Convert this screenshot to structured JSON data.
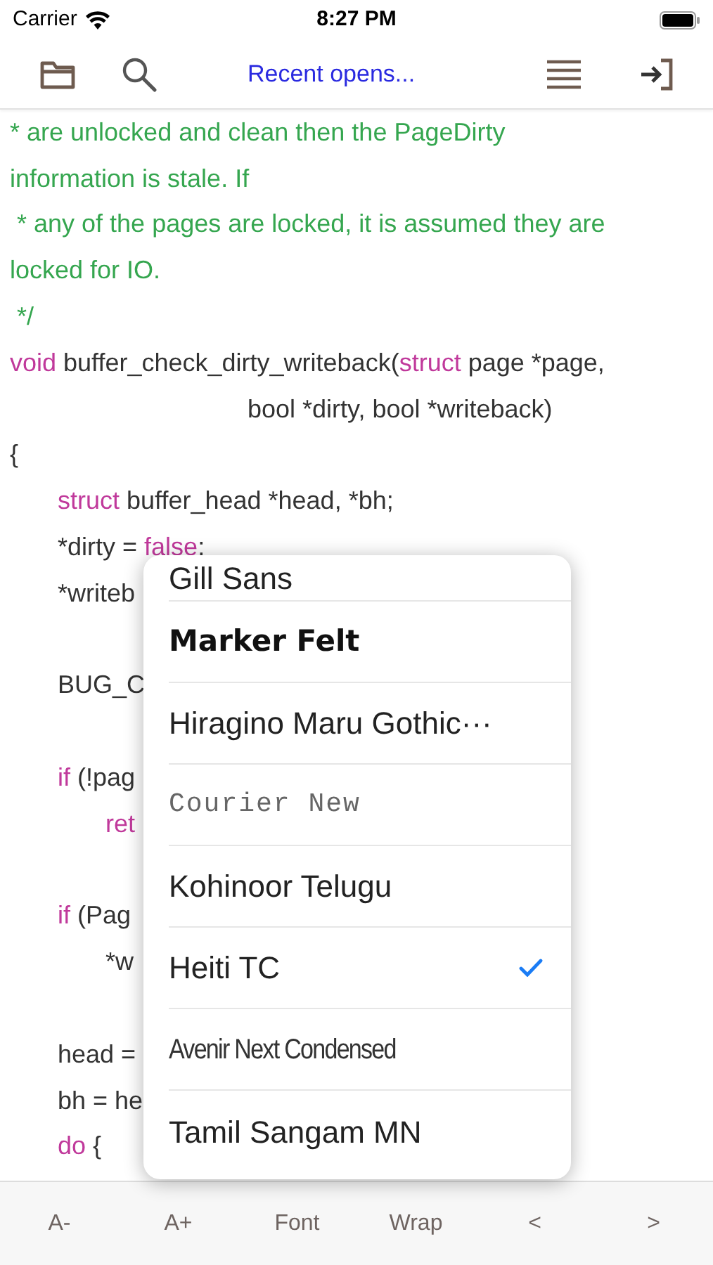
{
  "status_bar": {
    "carrier": "Carrier",
    "time": "8:27 PM"
  },
  "toolbar": {
    "title": "Recent opens..."
  },
  "code": [
    {
      "kind": "line",
      "segments": [
        {
          "kind": "comment",
          "text": "* are unlocked and clean then the PageDirty"
        }
      ]
    },
    {
      "kind": "line",
      "segments": [
        {
          "kind": "comment",
          "text": "information is stale. If"
        }
      ]
    },
    {
      "kind": "line",
      "segments": [
        {
          "kind": "comment",
          "text": " * any of the pages are locked, it is assumed they are"
        }
      ]
    },
    {
      "kind": "line",
      "segments": [
        {
          "kind": "comment",
          "text": "locked for IO."
        }
      ]
    },
    {
      "kind": "line",
      "segments": [
        {
          "kind": "comment",
          "text": " */"
        }
      ]
    },
    {
      "kind": "line",
      "segments": [
        {
          "kind": "keyword",
          "text": "void"
        },
        {
          "kind": "plain",
          "text": " buffer_check_dirty_writeback("
        },
        {
          "kind": "keyword",
          "text": "struct"
        },
        {
          "kind": "plain",
          "text": " page *page,"
        }
      ]
    },
    {
      "kind": "continuation",
      "segments": [
        {
          "kind": "plain",
          "text": "bool *dirty, bool *writeback)"
        }
      ]
    },
    {
      "kind": "line",
      "segments": [
        {
          "kind": "plain",
          "text": "{"
        }
      ],
      "children": [
        {
          "kind": "line",
          "segments": [
            {
              "kind": "keyword",
              "text": "struct"
            },
            {
              "kind": "plain",
              "text": " buffer_head *head, *bh;"
            }
          ]
        },
        {
          "kind": "line",
          "segments": [
            {
              "kind": "plain",
              "text": "*dirty = "
            },
            {
              "kind": "keyword",
              "text": "false"
            },
            {
              "kind": "plain",
              "text": ";"
            }
          ]
        },
        {
          "kind": "line",
          "segments": [
            {
              "kind": "plain",
              "text": "*writeb"
            }
          ]
        },
        {
          "kind": "blank"
        },
        {
          "kind": "line",
          "segments": [
            {
              "kind": "plain",
              "text": "BUG_C"
            }
          ]
        },
        {
          "kind": "blank"
        },
        {
          "kind": "line",
          "segments": [
            {
              "kind": "keyword",
              "text": "if"
            },
            {
              "kind": "plain",
              "text": " (!pag"
            }
          ],
          "children": [
            {
              "kind": "line",
              "segments": [
                {
                  "kind": "keyword",
                  "text": "ret"
                }
              ]
            }
          ]
        },
        {
          "kind": "blank"
        },
        {
          "kind": "line",
          "segments": [
            {
              "kind": "keyword",
              "text": "if"
            },
            {
              "kind": "plain",
              "text": " (Pag"
            }
          ],
          "children": [
            {
              "kind": "line",
              "segments": [
                {
                  "kind": "plain",
                  "text": "*w"
                }
              ]
            }
          ]
        },
        {
          "kind": "blank"
        },
        {
          "kind": "line",
          "segments": [
            {
              "kind": "plain",
              "text": "head ="
            }
          ]
        },
        {
          "kind": "line",
          "segments": [
            {
              "kind": "plain",
              "text": "bh = he"
            }
          ]
        },
        {
          "kind": "line",
          "segments": [
            {
              "kind": "keyword",
              "text": "do"
            },
            {
              "kind": "plain",
              "text": " {"
            }
          ]
        }
      ]
    }
  ],
  "font_menu": [
    {
      "label": "Gill Sans",
      "kind": "regular",
      "selected": false
    },
    {
      "label": "Marker Felt",
      "kind": "bold",
      "selected": false
    },
    {
      "label": "Hiragino Maru Gothic···",
      "kind": "regular",
      "selected": false
    },
    {
      "label": "Courier New",
      "kind": "mono",
      "selected": false
    },
    {
      "label": "Kohinoor Telugu",
      "kind": "regular",
      "selected": false
    },
    {
      "label": "Heiti TC",
      "kind": "regular",
      "selected": true
    },
    {
      "label": "Avenir Next Condensed",
      "kind": "condensed",
      "selected": false
    },
    {
      "label": "Tamil Sangam MN",
      "kind": "regular",
      "selected": false
    }
  ],
  "bottom_bar": [
    "A-",
    "A+",
    "Font",
    "Wrap",
    "<",
    ">"
  ]
}
